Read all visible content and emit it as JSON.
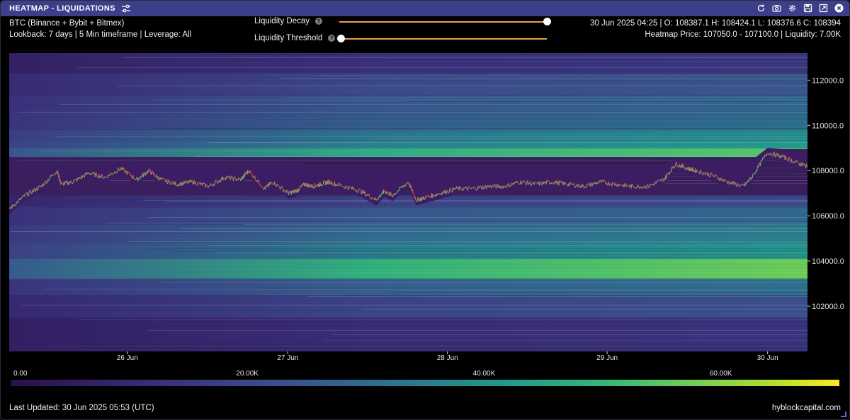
{
  "window": {
    "title": "HEATMAP - LIQUIDATIONS",
    "title_icons": [
      "refresh-icon",
      "camera-icon",
      "gear-icon",
      "save-icon",
      "expand-icon",
      "close-icon"
    ]
  },
  "info": {
    "symbol": "BTC (Binance + Bybit + Bitmex)",
    "settings": "Lookback: 7 days | 5 Min timeframe | Leverage: All",
    "ohlc": "30 Jun 2025 04:25 | O: 108387.1 H: 108424.1 L: 108376.6 C: 108394",
    "heatmap_price": "Heatmap Price: 107050.0 - 107100.0 | Liquidity: 7.00K"
  },
  "controls": {
    "decay_label": "Liquidity Decay",
    "threshold_label": "Liquidity Threshold",
    "help_glyph": "?",
    "decay_value": 1.0,
    "threshold_value": 0.0
  },
  "chart_data": {
    "type": "heatmap",
    "title": "",
    "y_ticks": [
      "112000.0",
      "110000.0",
      "108000.0",
      "106000.0",
      "104000.0",
      "102000.0"
    ],
    "y_tick_values": [
      112000,
      110000,
      108000,
      106000,
      104000,
      102000
    ],
    "ylim": [
      100000,
      113200
    ],
    "x_ticks": [
      "26 Jun",
      "27 Jun",
      "28 Jun",
      "29 Jun",
      "30 Jun"
    ],
    "x_tick_positions": [
      0.148,
      0.349,
      0.549,
      0.749,
      0.95
    ],
    "price_series": {
      "name": "",
      "t": [
        0,
        0.02,
        0.04,
        0.06,
        0.065,
        0.08,
        0.1,
        0.12,
        0.14,
        0.16,
        0.175,
        0.19,
        0.21,
        0.23,
        0.25,
        0.27,
        0.29,
        0.3,
        0.32,
        0.33,
        0.35,
        0.36,
        0.37,
        0.38,
        0.39,
        0.4,
        0.42,
        0.44,
        0.46,
        0.47,
        0.48,
        0.5,
        0.51,
        0.52,
        0.54,
        0.56,
        0.58,
        0.6,
        0.62,
        0.64,
        0.66,
        0.68,
        0.7,
        0.72,
        0.74,
        0.76,
        0.78,
        0.8,
        0.82,
        0.835,
        0.85,
        0.86,
        0.88,
        0.9,
        0.92,
        0.93,
        0.95,
        0.97,
        0.99,
        1.0
      ],
      "values": [
        106300,
        106900,
        107300,
        108000,
        107400,
        107500,
        107900,
        107700,
        108100,
        107600,
        108000,
        107600,
        107400,
        107500,
        107300,
        107700,
        107600,
        108000,
        107200,
        107500,
        107000,
        107100,
        107400,
        107300,
        107400,
        107500,
        107300,
        107100,
        106700,
        107100,
        106900,
        107500,
        106700,
        106800,
        107000,
        107200,
        107200,
        107300,
        107300,
        107500,
        107400,
        107500,
        107400,
        107300,
        107500,
        107400,
        107300,
        107300,
        107600,
        108300,
        108100,
        108000,
        107800,
        107500,
        107300,
        107700,
        108800,
        108600,
        108300,
        108200
      ]
    },
    "liquidity_scale": {
      "min": 0,
      "max": 70000,
      "ticks": [
        "0.00",
        "20.00K",
        "40.00K",
        "60.00K"
      ],
      "tick_values": [
        0,
        20000,
        40000,
        60000
      ]
    },
    "bands": [
      {
        "lo": 108600,
        "hi": 109000,
        "level": 0.78
      },
      {
        "lo": 109000,
        "hi": 109300,
        "level": 0.6
      },
      {
        "lo": 109300,
        "hi": 109800,
        "level": 0.55
      },
      {
        "lo": 109800,
        "hi": 110500,
        "level": 0.45
      },
      {
        "lo": 110500,
        "hi": 111300,
        "level": 0.42
      },
      {
        "lo": 111300,
        "hi": 112300,
        "level": 0.35
      },
      {
        "lo": 112300,
        "hi": 113200,
        "level": 0.22
      },
      {
        "lo": 106400,
        "hi": 106900,
        "level": 0.3
      },
      {
        "lo": 105600,
        "hi": 106400,
        "level": 0.42
      },
      {
        "lo": 104800,
        "hi": 105600,
        "level": 0.5
      },
      {
        "lo": 104100,
        "hi": 104800,
        "level": 0.58
      },
      {
        "lo": 103200,
        "hi": 104100,
        "level": 0.82
      },
      {
        "lo": 102500,
        "hi": 103200,
        "level": 0.45
      },
      {
        "lo": 101500,
        "hi": 102500,
        "level": 0.33
      },
      {
        "lo": 100000,
        "hi": 101500,
        "level": 0.2
      }
    ]
  },
  "footer": {
    "last_updated": "Last Updated: 30 Jun 2025 05:53 (UTC)",
    "brand": "hyblockcapital.com"
  }
}
